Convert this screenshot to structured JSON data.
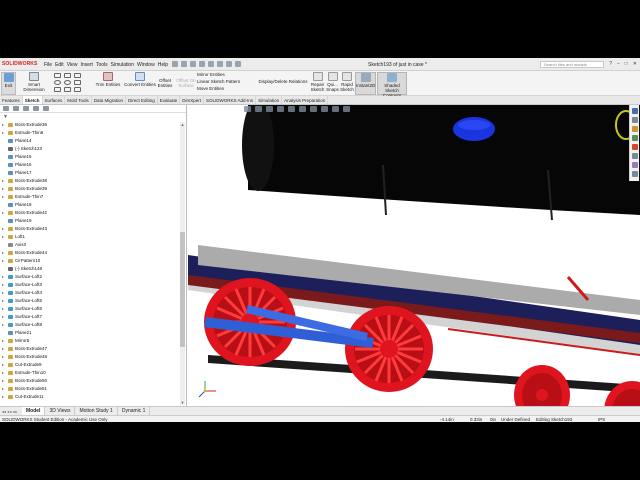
{
  "app": {
    "logo": "SOLIDWORKS",
    "doc_title": "Sketch193 of just in case *",
    "menus": [
      "File",
      "Edit",
      "View",
      "Insert",
      "Tools",
      "Simulation",
      "Window",
      "Help"
    ],
    "search_placeholder": "Search files and models",
    "win_controls": [
      "?",
      "–",
      "□",
      "✕"
    ]
  },
  "commands": {
    "exit": "Exit",
    "smart_dimension": "Smart Dimension",
    "trim_entities": "Trim Entities",
    "convert_entities": "Convert Entities",
    "offset": "Offset",
    "entities": "Entities",
    "offset_on": "Offset On",
    "surface": "Surface",
    "mirror_entities": "Mirror Entities",
    "linear_sketch_pattern": "Linear Sketch Pattern",
    "move_entities": "Move Entities",
    "display_delete_relations": "Display/Delete Relations",
    "repair": "Repair",
    "sketch": "Sketch",
    "quick": "Qui...",
    "snaps": "Snaps",
    "rapid": "Rapid",
    "instant2d": "Instant2D",
    "shaded_sketch": "Shaded Sketch",
    "contours": "Contours"
  },
  "tabs": [
    "Features",
    "Sketch",
    "Surfaces",
    "Mold Tools",
    "Data Migration",
    "Direct Editing",
    "Evaluate",
    "DimXpert",
    "SOLIDWORKS Add-Ins",
    "Simulation",
    "Analysis Preparation"
  ],
  "active_tab": 1,
  "tree": [
    {
      "label": "Boss-Extrude36",
      "icon": "#d4a43a",
      "arrow": "▸"
    },
    {
      "label": "Extrude-Thin6",
      "icon": "#d4a43a",
      "arrow": "▸"
    },
    {
      "label": "Plane14",
      "icon": "#5b8fc7",
      "arrow": ""
    },
    {
      "label": "(-) Sketch123",
      "icon": "#666666",
      "arrow": ""
    },
    {
      "label": "Plane15",
      "icon": "#5b8fc7",
      "arrow": ""
    },
    {
      "label": "Plane16",
      "icon": "#5b8fc7",
      "arrow": ""
    },
    {
      "label": "Plane17",
      "icon": "#5b8fc7",
      "arrow": ""
    },
    {
      "label": "Boss-Extrude38",
      "icon": "#d4a43a",
      "arrow": "▸"
    },
    {
      "label": "Boss-Extrude39",
      "icon": "#d4a43a",
      "arrow": "▸"
    },
    {
      "label": "Extrude-Thin7",
      "icon": "#d4a43a",
      "arrow": "▸"
    },
    {
      "label": "Plane18",
      "icon": "#5b8fc7",
      "arrow": ""
    },
    {
      "label": "Boss-Extrude42",
      "icon": "#d4a43a",
      "arrow": "▸"
    },
    {
      "label": "Plane19",
      "icon": "#5b8fc7",
      "arrow": ""
    },
    {
      "label": "Boss-Extrude43",
      "icon": "#d4a43a",
      "arrow": "▸"
    },
    {
      "label": "Loft1",
      "icon": "#d4a43a",
      "arrow": "▸"
    },
    {
      "label": "Axis3",
      "icon": "#888888",
      "arrow": ""
    },
    {
      "label": "Boss-Extrude44",
      "icon": "#d4a43a",
      "arrow": "▸"
    },
    {
      "label": "CirPattern10",
      "icon": "#d4a43a",
      "arrow": "▸"
    },
    {
      "label": "(-) Sketch148",
      "icon": "#666666",
      "arrow": ""
    },
    {
      "label": "Surface-Loft2",
      "icon": "#3f9bd1",
      "arrow": "▸"
    },
    {
      "label": "Surface-Loft3",
      "icon": "#3f9bd1",
      "arrow": "▸"
    },
    {
      "label": "Surface-Loft4",
      "icon": "#3f9bd1",
      "arrow": "▸"
    },
    {
      "label": "Surface-Loft5",
      "icon": "#3f9bd1",
      "arrow": "▸"
    },
    {
      "label": "Surface-Loft6",
      "icon": "#3f9bd1",
      "arrow": "▸"
    },
    {
      "label": "Surface-Loft7",
      "icon": "#3f9bd1",
      "arrow": "▸"
    },
    {
      "label": "Surface-Loft8",
      "icon": "#3f9bd1",
      "arrow": "▸"
    },
    {
      "label": "Plane21",
      "icon": "#5b8fc7",
      "arrow": ""
    },
    {
      "label": "Mirror5",
      "icon": "#d4a43a",
      "arrow": "▸"
    },
    {
      "label": "Boss-Extrude47",
      "icon": "#d4a43a",
      "arrow": "▸"
    },
    {
      "label": "Boss-Extrude48",
      "icon": "#d4a43a",
      "arrow": "▸"
    },
    {
      "label": "Cut-Extrude9",
      "icon": "#d4a43a",
      "arrow": "▸"
    },
    {
      "label": "Extrude-Thin10",
      "icon": "#d4a43a",
      "arrow": "▸"
    },
    {
      "label": "Boss-Extrude50",
      "icon": "#d4a43a",
      "arrow": "▸"
    },
    {
      "label": "Boss-Extrude51",
      "icon": "#d4a43a",
      "arrow": "▸"
    },
    {
      "label": "Cut-Extrude11",
      "icon": "#d4a43a",
      "arrow": "▸"
    }
  ],
  "bottom_tabs": [
    "Model",
    "3D Views",
    "Motion Study 1",
    "Dynamic 1"
  ],
  "status": {
    "edition": "SOLIDWORKS Student Edition - Academic Use Only",
    "x": "-4.14in",
    "y": "0.33in",
    "z": "0in",
    "state": "Under Defined",
    "editing": "Editing Sketch193",
    "units": "IPS"
  },
  "colors": {
    "wheel": "#e0141e",
    "rod": "#2f5fd6",
    "boiler": "#060606",
    "frame": "#1c1f5a",
    "accent": "#cc1b1b"
  }
}
